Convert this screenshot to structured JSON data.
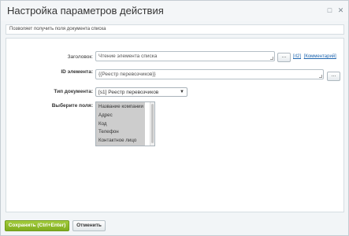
{
  "dialog": {
    "title": "Настройка параметров действия",
    "description": "Позволяет получить поля документа списка"
  },
  "titlebar_icons": [
    "minimize-icon",
    "close-icon"
  ],
  "fields": {
    "header": {
      "label": "Заголовок:",
      "value": "Чтение элемента списка",
      "dots": "...",
      "id_link": "[rl2]",
      "comment_link": "[Комментарий]"
    },
    "element_id": {
      "label": "ID элемента:",
      "value": "{{Реестр перевозчиков}}",
      "dots": "..."
    },
    "doc_type": {
      "label": "Тип документа:",
      "value": "[s1] Реестр перевозчиков"
    },
    "select_fields": {
      "label": "Выберите поля:",
      "options": [
        "Название компании",
        "Адрес",
        "Код",
        "Телефон",
        "Контактное лицо"
      ]
    }
  },
  "footer": {
    "save_label": "Сохранить (Ctrl+Enter)",
    "cancel_label": "Отменить"
  },
  "colors": {
    "save_button": "#8dbb25",
    "link": "#2067b0",
    "selected_options_bg": "#cdcdcd"
  }
}
